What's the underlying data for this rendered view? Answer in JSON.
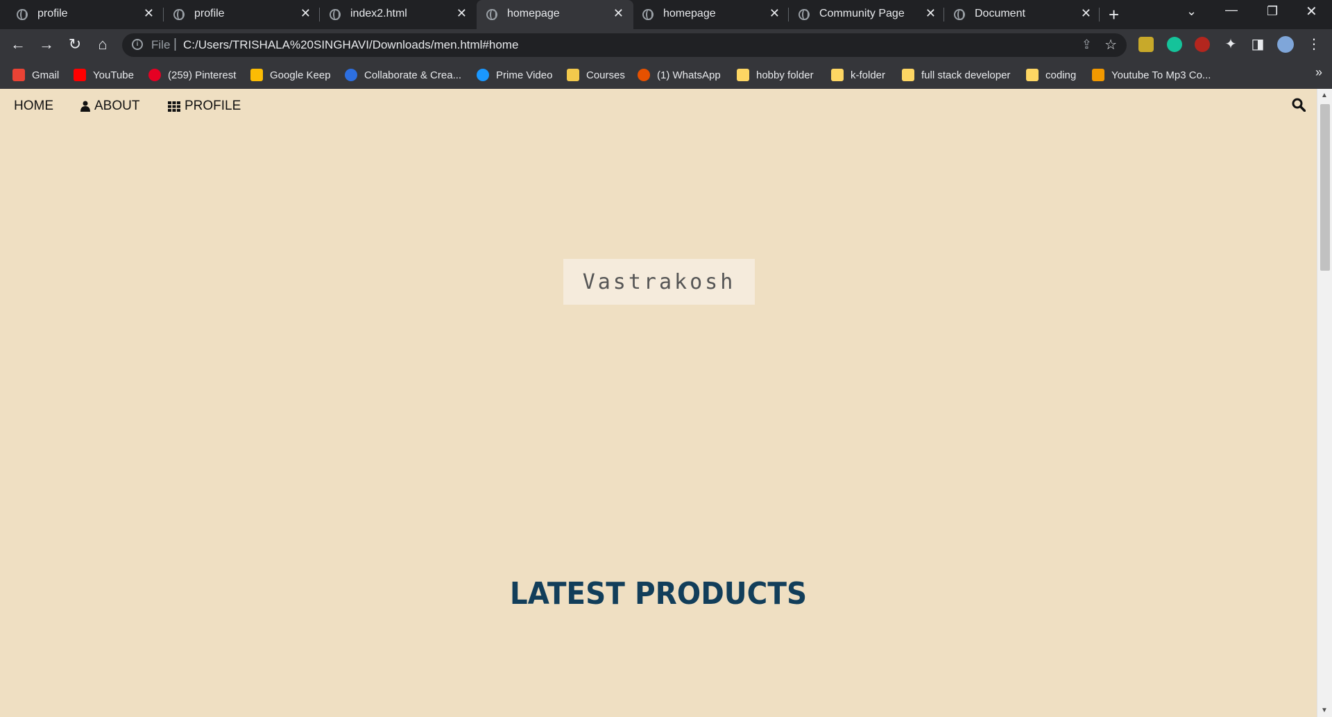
{
  "browser": {
    "tabs": [
      {
        "title": "profile",
        "active": false
      },
      {
        "title": "profile",
        "active": false
      },
      {
        "title": "index2.html",
        "active": false
      },
      {
        "title": "homepage",
        "active": true
      },
      {
        "title": "homepage",
        "active": false
      },
      {
        "title": "Community Page",
        "active": false
      },
      {
        "title": "Document",
        "active": false
      }
    ],
    "address_scheme": "File",
    "address_url": "C:/Users/TRISHALA%20SINGHAVI/Downloads/men.html#home",
    "bookmarks": [
      {
        "label": "Gmail",
        "color": "#ea4335"
      },
      {
        "label": "YouTube",
        "color": "#ff0000"
      },
      {
        "label": "(259) Pinterest",
        "color": "#e60023"
      },
      {
        "label": "Google Keep",
        "color": "#fbbc04"
      },
      {
        "label": "Collaborate & Crea...",
        "color": "#2d6fe0"
      },
      {
        "label": "Prime Video",
        "color": "#1a98ff"
      },
      {
        "label": "Courses",
        "color": "#f2c94c"
      },
      {
        "label": "(1) WhatsApp",
        "color": "#e65100"
      },
      {
        "label": "hobby folder",
        "color": "#fdd663"
      },
      {
        "label": "k-folder",
        "color": "#fdd663"
      },
      {
        "label": "full stack developer",
        "color": "#fdd663"
      },
      {
        "label": "coding",
        "color": "#fdd663"
      },
      {
        "label": "Youtube To Mp3 Co...",
        "color": "#f29900"
      }
    ]
  },
  "page": {
    "nav": {
      "home": "HOME",
      "about": "ABOUT",
      "profile": "PROFILE"
    },
    "brand": "Vastrakosh",
    "section_title": "LATEST PRODUCTS",
    "colors": {
      "background": "#efdfc2",
      "brand_box": "#f5ebdc",
      "section_title": "#123e5a"
    }
  }
}
